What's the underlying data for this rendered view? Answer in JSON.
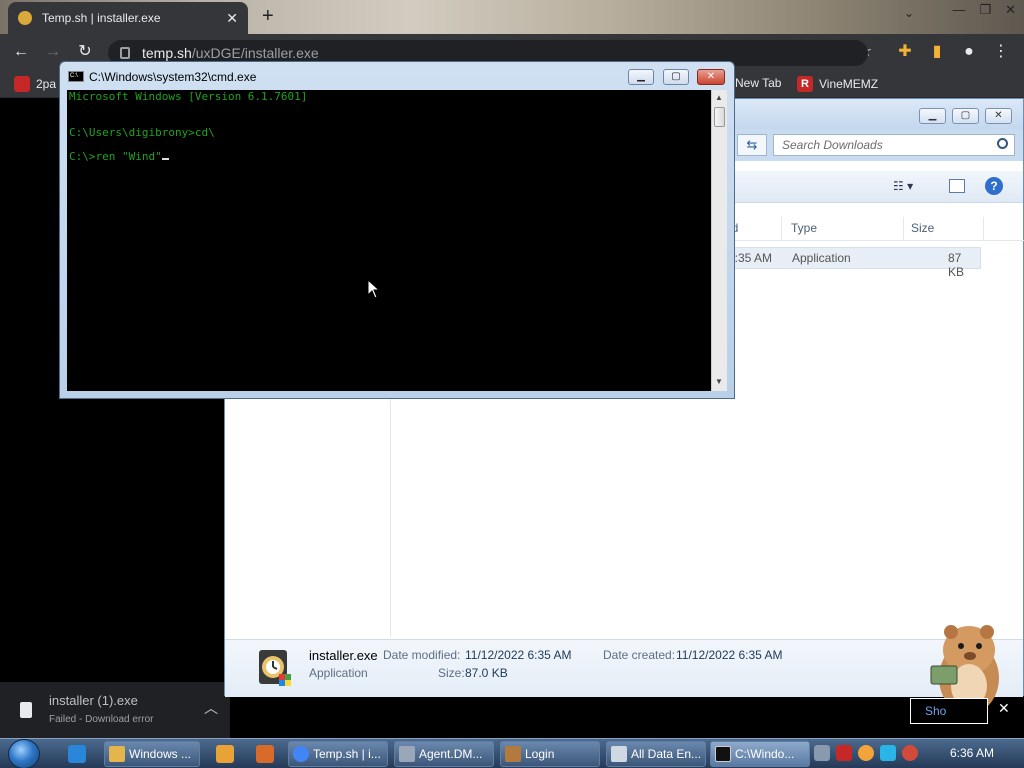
{
  "browser": {
    "tab_title": "Temp.sh | installer.exe",
    "tab_close": "✕",
    "new_tab": "+",
    "window_buttons": [
      "—",
      "❐",
      "✕"
    ],
    "url_host": "temp.sh",
    "url_path": "/uxDGE/installer.exe",
    "bookmarks": [
      {
        "label": "2pa",
        "icon_color": "#c62828"
      },
      {
        "label": "New Tab",
        "icon_color": "#4c4c4c"
      },
      {
        "label": "VineMEMZ",
        "icon_color": "#c62828",
        "icon_text": "R"
      }
    ],
    "download": {
      "name": "installer (1).exe",
      "status": "Failed - Download error"
    }
  },
  "explorer": {
    "search_placeholder": "Search Downloads",
    "columns": {
      "modified_partial": "ed",
      "type": "Type",
      "size": "Size"
    },
    "row": {
      "modified_partial": "5:35 AM",
      "type": "Application",
      "size": "87 KB"
    },
    "details": {
      "name": "installer.exe",
      "kind": "Application",
      "date_modified_label": "Date modified:",
      "date_modified": "11/12/2022 6:35 AM",
      "date_created_label": "Date created:",
      "date_created": "11/12/2022 6:35 AM",
      "size_label": "Size:",
      "size": "87.0 KB"
    }
  },
  "cmd": {
    "title": "C:\\Windows\\system32\\cmd.exe",
    "lines": [
      "Microsoft Windows [Version 6.1.7601]",
      "C:\\Users\\digibrony>cd\\",
      "C:\\>ren \"Wind\""
    ]
  },
  "taskbar": {
    "tasks": [
      {
        "label": "Windows ...",
        "icon_color": "#e3b54a"
      },
      {
        "label": "Temp.sh | i...",
        "icon_color": "#4285f4"
      },
      {
        "label": "Agent.DM...",
        "icon_color": "#9aa7b8"
      },
      {
        "label": "Login",
        "icon_color": "#b37a3f"
      },
      {
        "label": "All Data En...",
        "icon_color": "#cfd8e3"
      },
      {
        "label": "C:\\Windo...",
        "icon_color": "#111111"
      }
    ],
    "clock": "6:36 AM"
  },
  "hamster": {
    "button_label": "Sho",
    "close": "✕"
  }
}
